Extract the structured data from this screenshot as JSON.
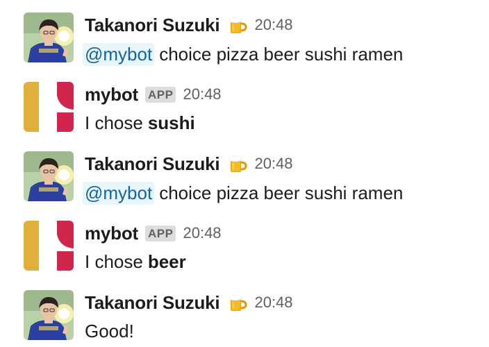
{
  "messages": [
    {
      "type": "user",
      "sender": "Takanori Suzuki",
      "status_icon": "beer-mug-icon",
      "time": "20:48",
      "mention": "@mybot",
      "text": "choice pizza beer sushi ramen"
    },
    {
      "type": "bot",
      "sender": "mybot",
      "badge": "APP",
      "time": "20:48",
      "text": "I chose",
      "bold": "sushi"
    },
    {
      "type": "user",
      "sender": "Takanori Suzuki",
      "status_icon": "beer-mug-icon",
      "time": "20:48",
      "mention": "@mybot",
      "text": "choice pizza beer sushi ramen"
    },
    {
      "type": "bot",
      "sender": "mybot",
      "badge": "APP",
      "time": "20:48",
      "text": "I chose",
      "bold": "beer"
    },
    {
      "type": "user",
      "sender": "Takanori Suzuki",
      "status_icon": "beer-mug-icon",
      "time": "20:48",
      "text": "Good!"
    }
  ],
  "colors": {
    "mention_bg": "#e8f5fa",
    "mention_text": "#1264a3",
    "bot_yellow": "#e0b03c",
    "bot_red": "#d0264d",
    "badge_bg": "#dddddd",
    "time_text": "#616061"
  }
}
